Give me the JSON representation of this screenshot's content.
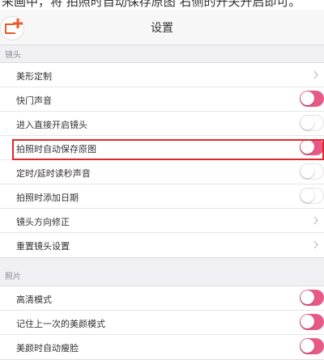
{
  "instruction_text": "采画中，将 拍照时自动保存原图 右侧的开关开启即可。",
  "header": {
    "title": "设置"
  },
  "sections": {
    "lens": {
      "label": "镜头",
      "items": [
        {
          "label": "美形定制",
          "control": "chevron"
        },
        {
          "label": "快门声音",
          "control": "toggle",
          "on": true
        },
        {
          "label": "进入直接开启镜头",
          "control": "toggle",
          "on": false
        },
        {
          "label": "拍照时自动保存原图",
          "control": "toggle",
          "on": true
        },
        {
          "label": "定时/延时读秒声音",
          "control": "toggle",
          "on": false
        },
        {
          "label": "拍照时添加日期",
          "control": "toggle",
          "on": false
        },
        {
          "label": "镜头方向修正",
          "control": "chevron"
        },
        {
          "label": "重置镜头设置",
          "control": "chevron"
        }
      ]
    },
    "photo": {
      "label": "照片",
      "items": [
        {
          "label": "高清模式",
          "control": "toggle",
          "on": true
        },
        {
          "label": "记住上一次的美颜模式",
          "control": "toggle",
          "on": true
        },
        {
          "label": "美颜时自动瘦脸",
          "control": "toggle",
          "on": true
        }
      ]
    }
  },
  "colors": {
    "toggle_on": "#e85a86",
    "highlight_box": "#e2262a",
    "logo_accent": "#e85a2b"
  },
  "icons": {
    "logo": "photo-add-icon",
    "chevron": "chevron-right-icon"
  }
}
